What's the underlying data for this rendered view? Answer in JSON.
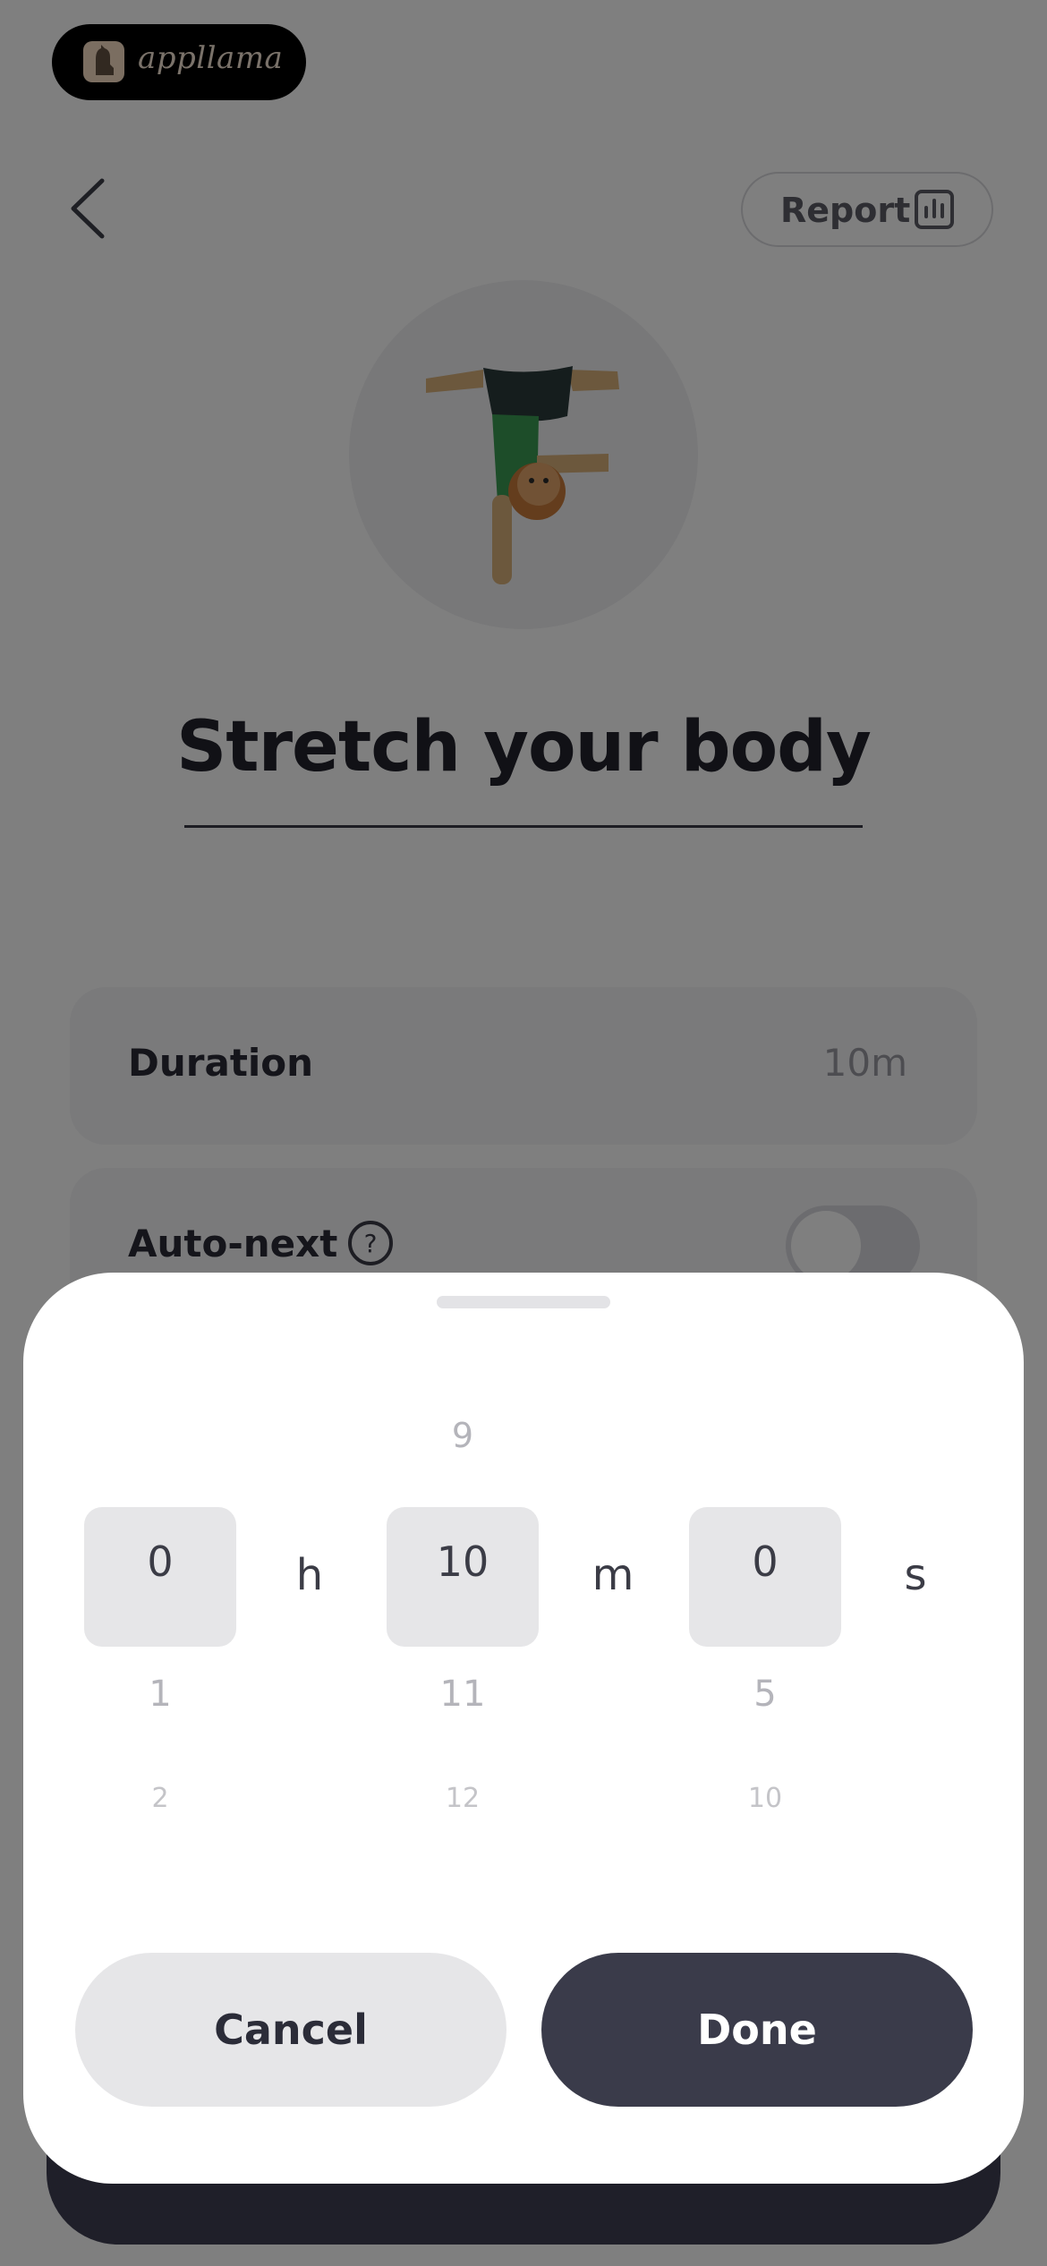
{
  "badge": {
    "text": "appllama"
  },
  "header": {
    "report_label": "Report"
  },
  "exercise": {
    "title": "Stretch your body"
  },
  "settings": {
    "duration_label": "Duration",
    "duration_value": "10m",
    "autonext_label": "Auto-next",
    "autonext_on": false
  },
  "picker": {
    "hours": {
      "above": "",
      "selected": "0",
      "below1": "1",
      "below2": "2",
      "unit": "h"
    },
    "minutes": {
      "above": "9",
      "selected": "10",
      "below1": "11",
      "below2": "12",
      "unit": "m"
    },
    "seconds": {
      "above": "",
      "selected": "0",
      "below1": "5",
      "below2": "10",
      "unit": "s"
    }
  },
  "actions": {
    "cancel_label": "Cancel",
    "done_label": "Done"
  },
  "colors": {
    "accent_dark": "#3a3b4a",
    "selection": "#e6e6e8",
    "overlay": "rgba(0,0,0,0.5)"
  }
}
